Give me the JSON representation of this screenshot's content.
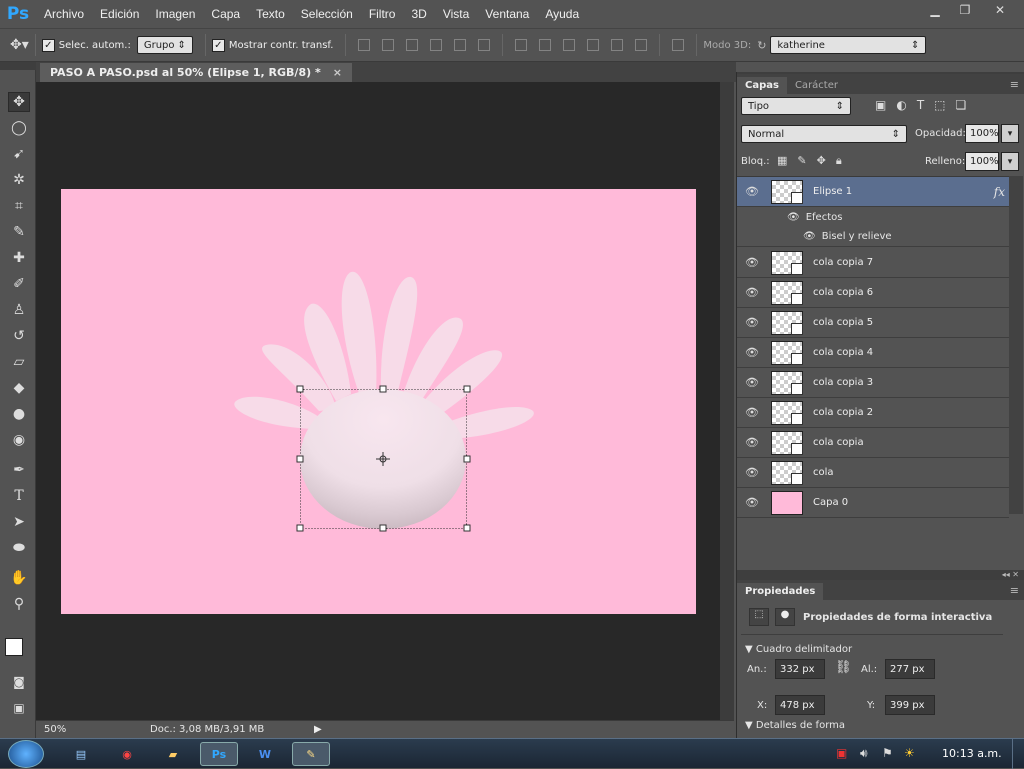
{
  "app": {
    "logo": "Ps"
  },
  "menu": [
    "Archivo",
    "Edición",
    "Imagen",
    "Capa",
    "Texto",
    "Selección",
    "Filtro",
    "3D",
    "Vista",
    "Ventana",
    "Ayuda"
  ],
  "options": {
    "auto_select_label": "Selec. autom.:",
    "auto_select_value": "Grupo",
    "show_transform_label": "Mostrar contr. transf.",
    "mode3d_label": "Modo 3D:",
    "user_value": "katherine"
  },
  "document": {
    "tab_title": "PASO A PASO.psd al 50% (Elipse 1, RGB/8) *",
    "close": "×"
  },
  "status": {
    "zoom": "50%",
    "doc": "Doc.: 3,08 MB/3,91 MB"
  },
  "layers_panel": {
    "tabs": [
      "Capas",
      "Carácter"
    ],
    "filter": "Tipo",
    "blend_mode": "Normal",
    "opacity_label": "Opacidad:",
    "opacity_value": "100%",
    "lock_label": "Bloq.:",
    "fill_label": "Relleno:",
    "fill_value": "100%",
    "selected_layer": "Elipse 1",
    "fx": "fx",
    "effects_label": "Efectos",
    "effect_name": "Bisel y relieve",
    "layers": [
      "cola copia 7",
      "cola copia 6",
      "cola copia 5",
      "cola copia 4",
      "cola copia 3",
      "cola copia 2",
      "cola copia",
      "cola",
      "Capa 0"
    ]
  },
  "properties_panel": {
    "title": "Propiedades",
    "subtitle": "Propiedades de forma interactiva",
    "section_bbox": "Cuadro delimitador",
    "w_label": "An.:",
    "w_value": "332 px",
    "h_label": "Al.:",
    "h_value": "277 px",
    "x_label": "X:",
    "x_value": "478 px",
    "y_label": "Y:",
    "y_value": "399 px",
    "section_shape": "Detalles de forma"
  },
  "taskbar": {
    "clock": "10:13 a.m."
  },
  "colors": {
    "canvas": "#ffbad9",
    "petal": "#f7dbe8",
    "selected_layer": "#5b6e8f",
    "ps_blue": "#31a8ff"
  }
}
